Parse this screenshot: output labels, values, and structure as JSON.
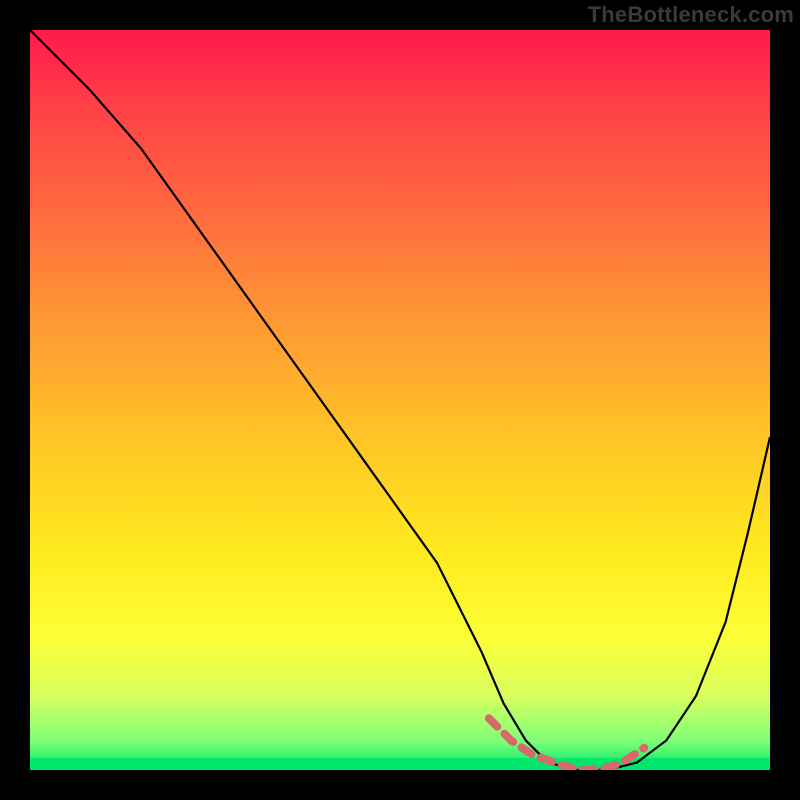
{
  "watermark": "TheBottleneck.com",
  "chart_data": {
    "type": "line",
    "title": "",
    "xlabel": "",
    "ylabel": "",
    "xlim": [
      0,
      100
    ],
    "ylim": [
      0,
      100
    ],
    "grid": false,
    "series": [
      {
        "name": "bottleneck-curve",
        "color": "#000000",
        "x": [
          0,
          3,
          8,
          15,
          25,
          35,
          45,
          55,
          61,
          64,
          67,
          70,
          74,
          78,
          82,
          86,
          90,
          94,
          97,
          100
        ],
        "y": [
          100,
          97,
          92,
          84,
          70,
          56,
          42,
          28,
          16,
          9,
          4,
          1,
          0,
          0,
          1,
          4,
          10,
          20,
          32,
          45
        ]
      }
    ],
    "highlight_band": {
      "name": "optimal-range-dashes",
      "color": "#d46a6a",
      "x": [
        62,
        65,
        68,
        71,
        74,
        77,
        80,
        83
      ],
      "y": [
        7,
        4,
        2,
        1,
        0,
        0,
        1,
        3
      ]
    },
    "background": {
      "type": "vertical-gradient",
      "stops": [
        {
          "pos": 0.0,
          "color": "#ff1a4b"
        },
        {
          "pos": 0.25,
          "color": "#ff6b3e"
        },
        {
          "pos": 0.55,
          "color": "#ffc427"
        },
        {
          "pos": 0.82,
          "color": "#fbff35"
        },
        {
          "pos": 1.0,
          "color": "#00e86b"
        }
      ]
    }
  }
}
